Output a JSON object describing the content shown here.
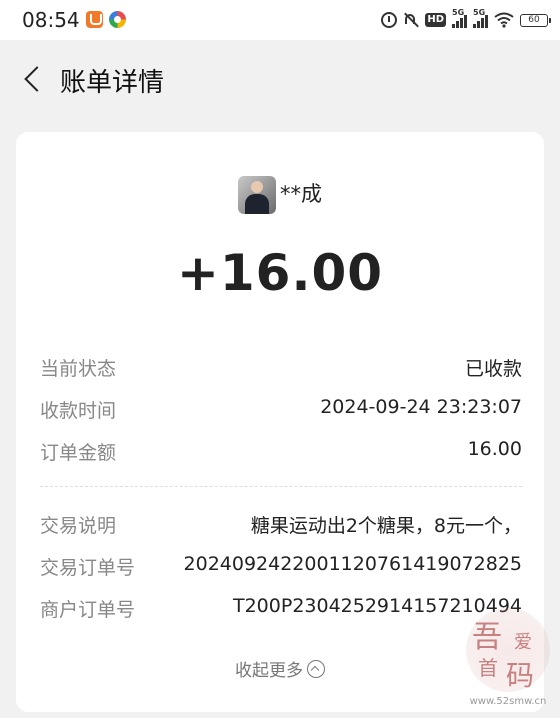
{
  "status_bar": {
    "time": "08:54",
    "battery": "60",
    "signal_labels": [
      "5G",
      "5G"
    ],
    "hd_label": "HD",
    "icons": [
      "app-orange-icon",
      "app-multicolor-icon",
      "alarm-icon",
      "mute-icon",
      "hd-icon",
      "signal-icon",
      "signal-icon",
      "wifi-icon",
      "battery-icon"
    ]
  },
  "header": {
    "title": "账单详情",
    "back_icon": "back-arrow-icon"
  },
  "payee": {
    "name": "**成",
    "avatar_icon": "avatar"
  },
  "amount": "+16.00",
  "details": [
    {
      "label": "当前状态",
      "value": "已收款"
    },
    {
      "label": "收款时间",
      "value": "2024-09-24 23:23:07"
    },
    {
      "label": "订单金额",
      "value": "16.00"
    }
  ],
  "extra_details": [
    {
      "label": "交易说明",
      "value": "糖果运动出2个糖果，8元一个，"
    },
    {
      "label": "交易订单号",
      "value": "20240924220011207614190728​25"
    },
    {
      "label": "商户订单号",
      "value": "T200P230425291415721049​4"
    }
  ],
  "collapse_label": "收起更多",
  "watermark": {
    "glyphs": [
      "吾",
      "爱",
      "首",
      "码"
    ],
    "url": "www.52smw.cn"
  },
  "colors": {
    "background": "#f1f1f1",
    "card": "#ffffff",
    "label_gray": "#888888",
    "text": "#222222"
  }
}
